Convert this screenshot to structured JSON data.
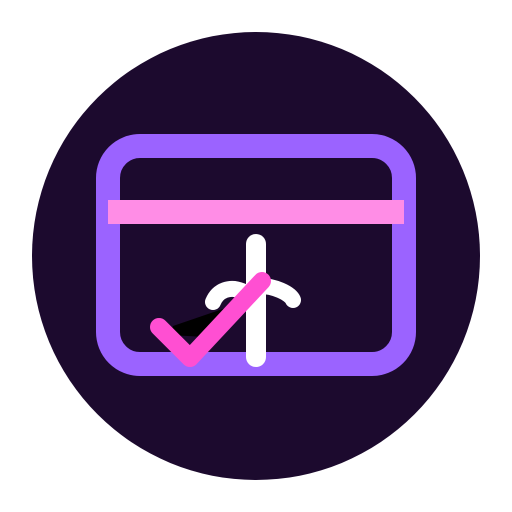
{
  "icon": {
    "name": "payment-approved-icon",
    "colors": {
      "background": "#ffffff",
      "badge": "#1c0a2e",
      "card_outline": "#9b63ff",
      "stripe": "#ff8de6",
      "glyph": "#ffffff",
      "check": "#ff4fd2",
      "shadow": "#000000"
    }
  }
}
